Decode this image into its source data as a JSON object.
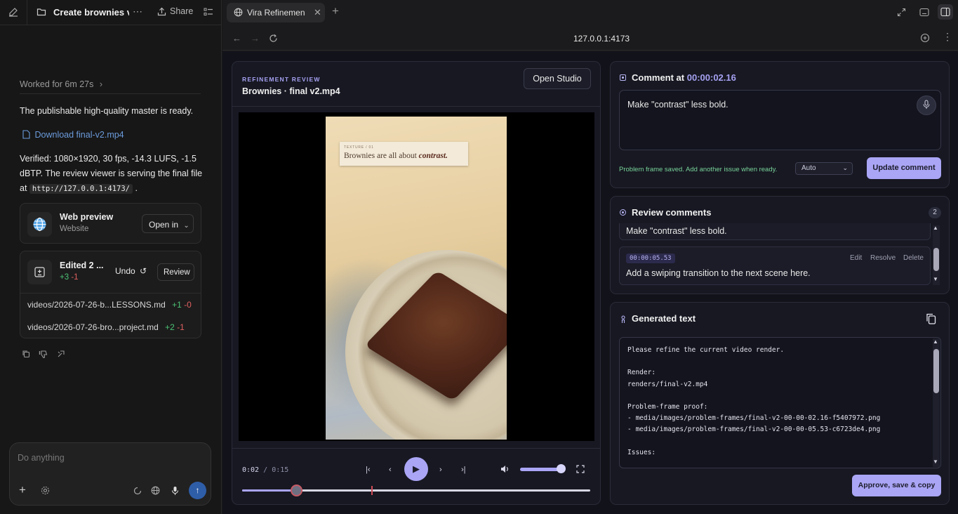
{
  "chat": {
    "title": "Create brownies vi",
    "share_label": "Share",
    "worked_label": "Worked for 6m 27s",
    "message_ready": "The publishable high-quality master is ready.",
    "download_link": "Download final-v2.mp4",
    "verified_text": "Verified: 1080×1920, 30 fps, -14.3 LUFS, -1.5 dBTP. The review viewer is serving the final file at",
    "verified_url": "http://127.0.0.1:4173/",
    "verified_end": ".",
    "web_preview": {
      "title": "Web preview",
      "subtitle": "Website",
      "open_in_label": "Open in"
    },
    "edited": {
      "title": "Edited 2 ...",
      "added": "+3",
      "removed": "-1",
      "undo_label": "Undo",
      "review_label": "Review",
      "files": [
        {
          "name": "videos/2026-07-26-b...LESSONS.md",
          "added": "+1",
          "removed": "-0"
        },
        {
          "name": "videos/2026-07-26-bro...project.md",
          "added": "+2",
          "removed": "-1"
        }
      ]
    },
    "composer_placeholder": "Do anything"
  },
  "browser": {
    "tab_title": "Vira Refinement",
    "url": "127.0.0.1:4173"
  },
  "review": {
    "kicker": "REFINEMENT REVIEW",
    "video_name": "Brownies · final v2.mp4",
    "open_studio_label": "Open Studio",
    "frame_caption_kicker": "TEXTURE / 01",
    "frame_caption_prefix": "Brownies are all about",
    "frame_caption_emph": "contrast.",
    "time_current": "0:02",
    "time_sep": "/",
    "time_total": "0:15",
    "progress_fraction": 0.155,
    "marker_fraction": 0.37,
    "volume_fraction": 1.0
  },
  "comment": {
    "title_prefix": "Comment at",
    "timestamp": "00:00:02.16",
    "text": "Make \"contrast\" less bold.",
    "saved_note": "Problem frame saved. Add another issue when ready.",
    "mode_value": "Auto",
    "update_label": "Update comment"
  },
  "comments": {
    "title": "Review comments",
    "count": "2",
    "items": [
      {
        "text": "Make \"contrast\" less bold."
      },
      {
        "timestamp": "00:00:05.53",
        "text": "Add a swiping transition to the next scene here.",
        "edit": "Edit",
        "resolve": "Resolve",
        "delete": "Delete"
      }
    ]
  },
  "generated": {
    "title": "Generated text",
    "lines": [
      "Please refine the current video render.",
      "",
      "Render:",
      "renders/final-v2.mp4",
      "",
      "Problem-frame proof:",
      "- media/images/problem-frames/final-v2-00-00-02.16-f5407972.png",
      "- media/images/problem-frames/final-v2-00-00-05.53-c6723de4.png",
      "",
      "Issues:"
    ],
    "approve_label": "Approve, save & copy"
  },
  "colors": {
    "accent": "#aaa5f5",
    "link": "#6b9bdb",
    "add": "#4cc275",
    "remove": "#e06060",
    "marker": "#d24b55"
  }
}
